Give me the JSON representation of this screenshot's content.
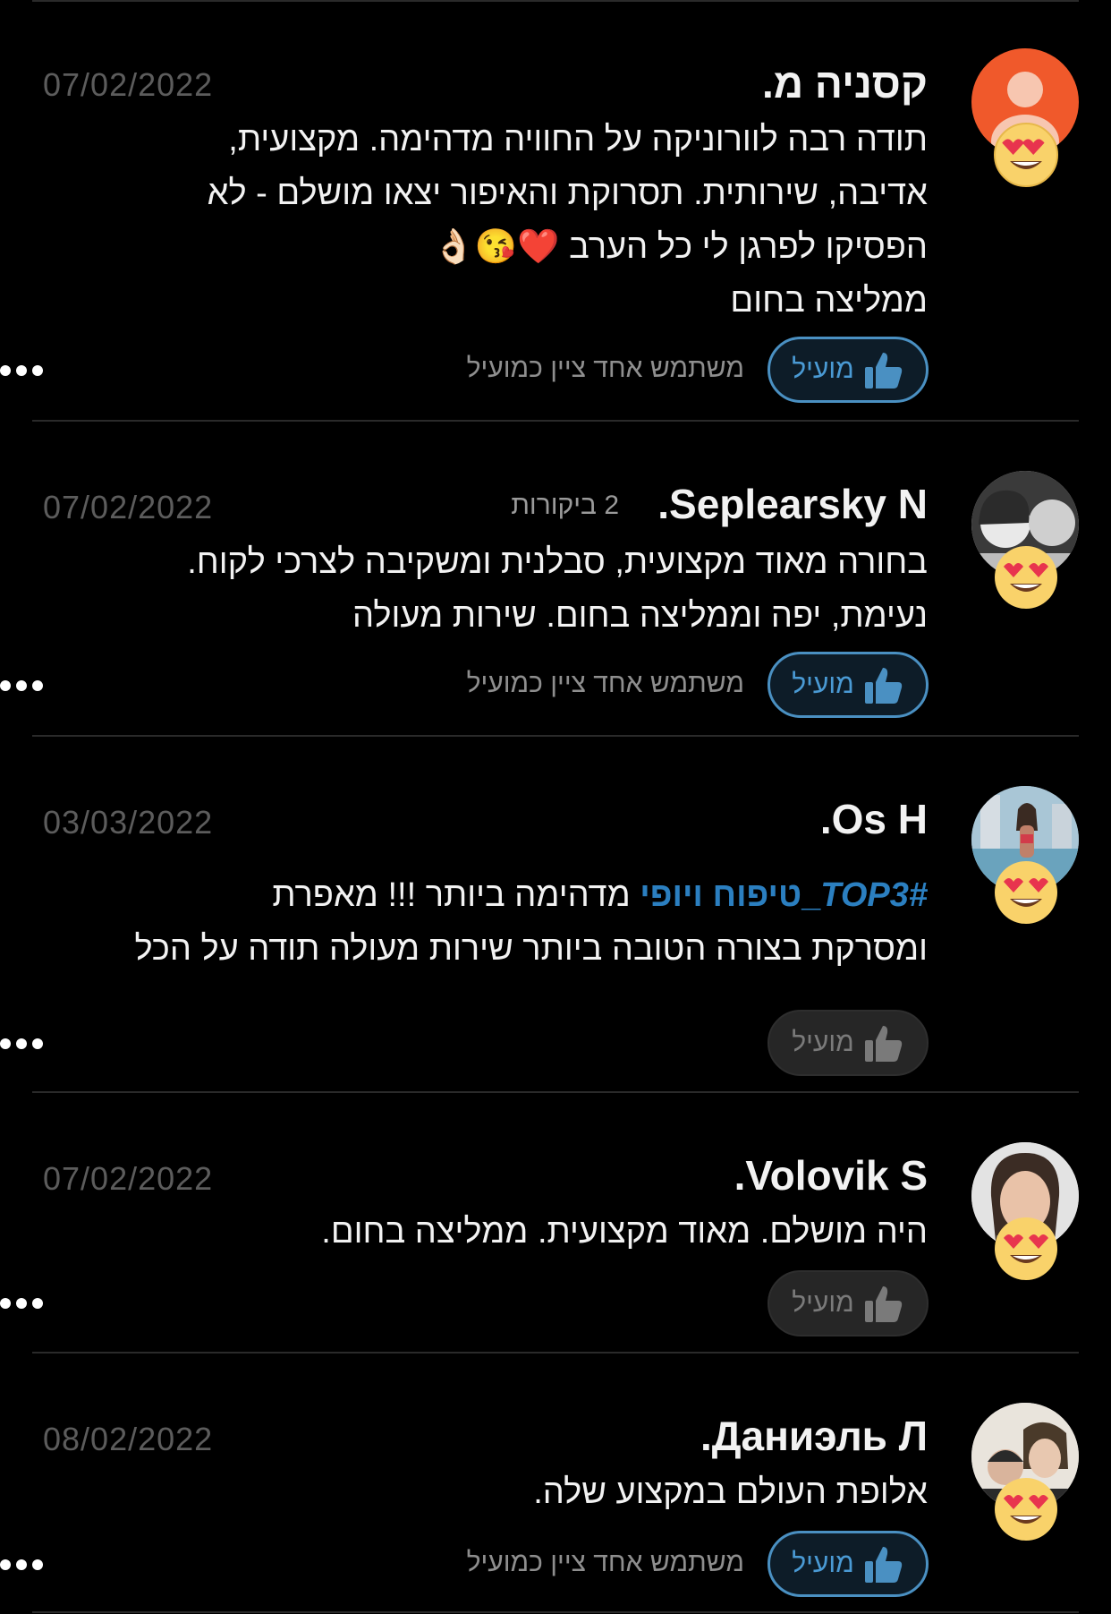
{
  "helpful_label": "מועיל",
  "colors": {
    "accent": "#4a90c2",
    "background": "#000000",
    "divider": "#2a2a2a"
  },
  "reviews": [
    {
      "name": "קסניה מ.",
      "review_count": "",
      "date": "07/02/2022",
      "avatar": "orange-user-placeholder",
      "reaction_icon": "heart-eyes-emoji-icon",
      "lines": [
        "תודה רבה לוורוניקה על החוויה מדהימה. מקצועית,",
        "אדיבה, שירותית. תסרוקת והאיפור יצאו מושלם - לא",
        "הפסיקו לפרגן לי כל הערב",
        "ממליצה בחום"
      ],
      "emojis": "❤️😘👌🏻",
      "helpful_active": true,
      "helpful_note": "משתמש אחד ציין כמועיל"
    },
    {
      "name": "Seplearsky N.",
      "review_count": "2 ביקורות",
      "date": "07/02/2022",
      "avatar": "photo-two-people",
      "reaction_icon": "heart-eyes-emoji-icon",
      "lines": [
        "בחורה מאוד מקצועית,  סבלנית ומשקיבה לצרכי לקוח.",
        "נעימת,  יפה וממליצה בחום.  שירות מעולה"
      ],
      "helpful_active": true,
      "helpful_note": "משתמש אחד ציין כמועיל"
    },
    {
      "name": "Os H.",
      "review_count": "",
      "date": "03/03/2022",
      "avatar": "photo-woman-pool",
      "reaction_icon": "heart-eyes-emoji-icon",
      "hashtag_en": "#TOP3",
      "hashtag_he": "_טיפוח ויופי",
      "line1_rest": " מדהימה ביותר !!!  מאפרת",
      "line2": "ומסרקת בצורה הטובה ביותר שירות מעולה תודה על הכל",
      "helpful_active": false,
      "helpful_note": ""
    },
    {
      "name": "Volovik S.",
      "review_count": "",
      "date": "07/02/2022",
      "avatar": "photo-woman-portrait",
      "reaction_icon": "heart-eyes-emoji-icon",
      "lines": [
        "היה מושלם. מאוד מקצועית. ממליצה בחום."
      ],
      "helpful_active": false,
      "helpful_note": ""
    },
    {
      "name": "Даниэль Л.",
      "review_count": "",
      "date": "08/02/2022",
      "avatar": "photo-couple",
      "reaction_icon": "heart-eyes-emoji-icon",
      "lines": [
        "אלופת העולם במקצוע שלה."
      ],
      "helpful_active": true,
      "helpful_note": "משתמש אחד ציין כמועיל"
    }
  ]
}
